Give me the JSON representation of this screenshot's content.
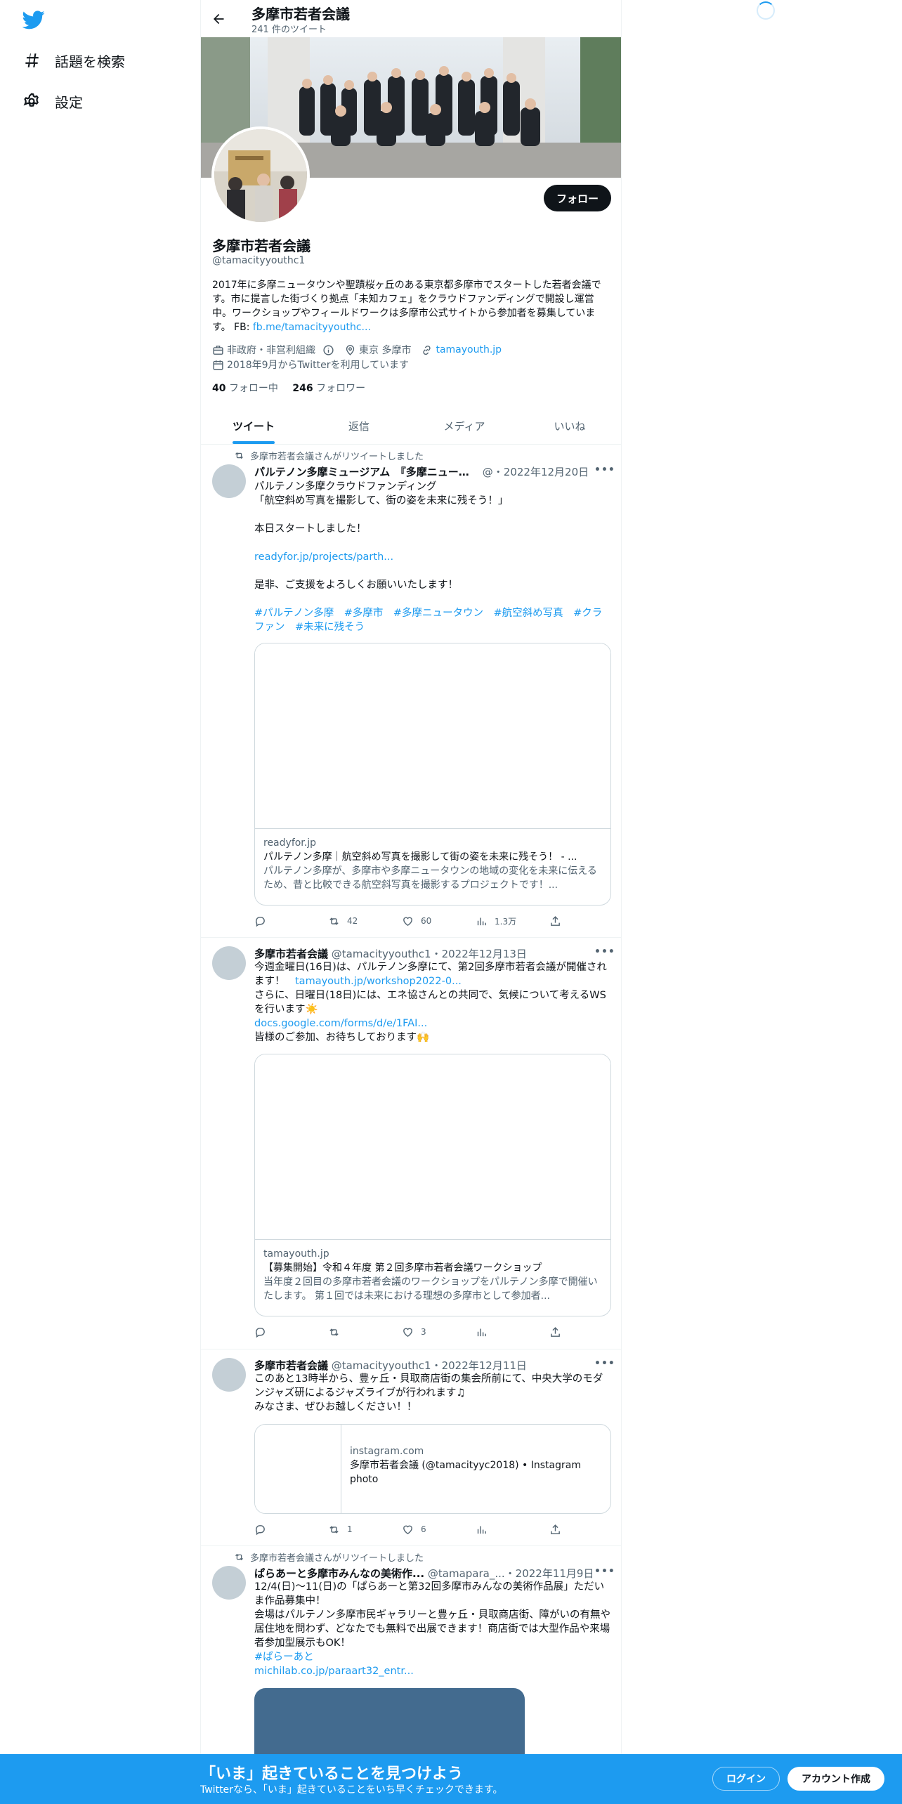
{
  "sidebar": {
    "items": [
      {
        "label": "話題を検索",
        "icon": "hashtag-icon"
      },
      {
        "label": "設定",
        "icon": "gear-icon"
      }
    ]
  },
  "header": {
    "title": "多摩市若者会議",
    "subtitle": "241 件のツイート"
  },
  "profile": {
    "name": "多摩市若者会議",
    "handle": "@tamacityyouthc1",
    "follow_label": "フォロー",
    "bio": "2017年に多摩ニュータウンや聖蹟桜ヶ丘のある東京都多摩市でスタートした若者会議です。市に提言した街づくり拠点「未知カフェ」をクラウドファンディングで開設し運営中。ワークショップやフィールドワークは多摩市公式サイトから参加者を募集しています。 FB: ",
    "bio_link": "fb.me/tamacityyouthc...",
    "category": "非政府・非営利組織",
    "location": "東京 多摩市",
    "website": "tamayouth.jp",
    "joined": "2018年9月からTwitterを利用しています",
    "following_count": "40",
    "following_label": "フォロー中",
    "followers_count": "246",
    "followers_label": "フォロワー"
  },
  "tabs": [
    "ツイート",
    "返信",
    "メディア",
    "いいね"
  ],
  "tweets": [
    {
      "retweeted_by": "多摩市若者会議さんがリツイートしました",
      "author": "パルテノン多摩ミュージアム 『多摩ニュータウン...',",
      "author_display": "パルテノン多摩ミュージアム　『多摩ニュータ...",
      "handle_date": "@・2022年12月20日",
      "text": "パルテノン多摩クラウドファンディング\n「航空斜め写真を撮影して、街の姿を未来に残そう！」\n\n本日スタートしました！\n\n",
      "link": "readyfor.jp/projects/parth...",
      "text2": "是非、ご支援をよろしくお願いいたします！",
      "hashtags": "#パルテノン多摩　#多摩市　#多摩ニュータウン　#航空斜め写真　#クラファン　#未来に残そう",
      "card": {
        "domain": "readyfor.jp",
        "title": "パルテノン多摩｜航空斜め写真を撮影して街の姿を未来に残そう！ - ...",
        "desc": "パルテノン多摩が、多摩市や多摩ニュータウンの地域の変化を未来に伝えるため、昔と比較できる航空斜写真を撮影するプロジェクトです！..."
      },
      "retweets": "42",
      "likes": "60",
      "views": "1.3万"
    },
    {
      "author": "多摩市若者会議",
      "handle_date": "@tamacityyouthc1・2022年12月13日",
      "text": "今週金曜日(16日)は、パルテノン多摩にて、第2回多摩市若者会議が開催されます！　",
      "link": "tamayouth.jp/workshop2022-0...",
      "text2": "さらに、日曜日(18日)には、エネ協さんとの共同で、気候について考えるWSを行います☀️",
      "link2": "docs.google.com/forms/d/e/1FAI...",
      "text3": "皆様のご参加、お待ちしております🙌",
      "card": {
        "domain": "tamayouth.jp",
        "title": "【募集開始】令和４年度 第２回多摩市若者会議ワークショップ",
        "desc": "当年度２回目の多摩市若者会議のワークショップをパルテノン多摩で開催いたします。 第１回では未来における理想の多摩市として参加者..."
      },
      "retweets": "",
      "likes": "3",
      "views": ""
    },
    {
      "author": "多摩市若者会議",
      "handle_date": "@tamacityyouthc1・2022年12月11日",
      "text": "このあと13時半から、豊ヶ丘・貝取商店街の集会所前にて、中央大学のモダンジャズ研によるジャズライブが行われます♫\nみなさま、ぜひお越しください！！",
      "card": {
        "domain": "instagram.com",
        "title": "多摩市若者会議 (@tamacityyc2018) • Instagram photo"
      },
      "retweets": "1",
      "likes": "6",
      "views": ""
    },
    {
      "retweeted_by": "多摩市若者会議さんがリツイートしました",
      "author": "ぱらあーと多摩市みんなの美術作...",
      "handle_date": "@tamapara_...・2022年11月9日",
      "text": "12/4(日)～11(日)の「ぱらあーと第32回多摩市みんなの美術作品展」ただいま作品募集中！\n会場はパルテノン多摩市民ギャラリーと豊ヶ丘・貝取商店街、障がいの有無や居住地を問わず、どなたでも無料で出展できます！商店街では大型作品や来場者参加型展示もOK！",
      "hashtag": "#ぱらーあと",
      "link": "michilab.co.jp/paraart32_entr..."
    }
  ],
  "bottom_bar": {
    "headline": "「いま」起きていることを見つけよう",
    "sub": "Twitterなら、「いま」起きていることをいち早くチェックできます。",
    "login": "ログイン",
    "signup": "アカウント作成"
  },
  "colors": {
    "accent": "#1d9bf0",
    "text": "#0f1419",
    "muted": "#536471"
  }
}
